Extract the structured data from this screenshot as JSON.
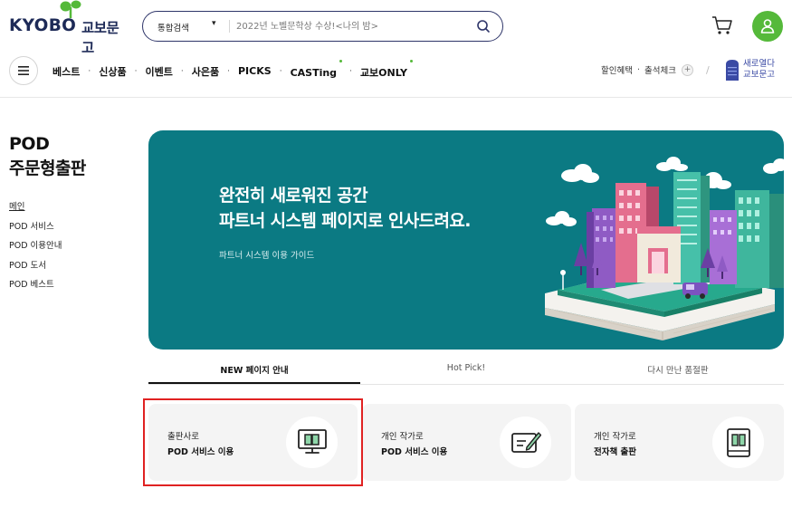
{
  "header": {
    "logo_en": "KYOBO",
    "logo_kr": "교보문고",
    "search": {
      "category": "통합검색",
      "placeholder": "2022년 노벨문학상 수상!<나의 밤>"
    }
  },
  "nav": {
    "items": [
      {
        "label": "베스트",
        "new": false
      },
      {
        "label": "신상품",
        "new": false
      },
      {
        "label": "이벤트",
        "new": false
      },
      {
        "label": "사은품",
        "new": false
      },
      {
        "label": "PICKS",
        "new": false
      },
      {
        "label": "CASTing",
        "new": true
      },
      {
        "label": "교보ONLY",
        "new": true
      }
    ],
    "util": {
      "discount": "할인혜택",
      "checkin": "출석체크",
      "saero_line1": "새로열다",
      "saero_line2": "교보문고"
    }
  },
  "sidebar": {
    "title_line1": "POD",
    "title_line2": "주문형출판",
    "items": [
      "메인",
      "POD 서비스",
      "POD 이용안내",
      "POD 도서",
      "POD 베스트"
    ]
  },
  "banner": {
    "line1": "완전히 새로워진 공간",
    "line2": "파트너 시스템 페이지로 인사드려요.",
    "sub": "파트너 시스템 이용 가이드"
  },
  "tabs": [
    "NEW 페이지 안내",
    "Hot Pick!",
    "다시 만난 품절판"
  ],
  "cards": [
    {
      "line1": "출판사로",
      "line2": "POD 서비스 이용",
      "icon": "computer-book-icon"
    },
    {
      "line1": "개인 작가로",
      "line2": "POD 서비스 이용",
      "icon": "card-pen-icon"
    },
    {
      "line1": "개인 작가로",
      "line2": "전자책 출판",
      "icon": "ebook-device-icon"
    }
  ],
  "colors": {
    "brand_navy": "#1d2a57",
    "brand_green": "#55b93a",
    "banner_teal": "#0b7a83",
    "highlight": "#e02222"
  }
}
